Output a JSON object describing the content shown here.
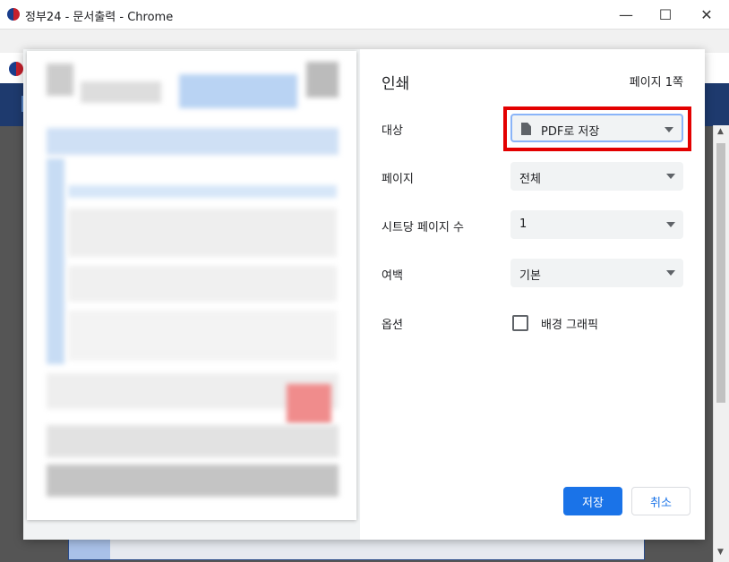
{
  "window": {
    "title": "정부24 - 문서출력 - Chrome"
  },
  "window_controls": {
    "minimize": "—",
    "maximize": "☐",
    "close": "✕"
  },
  "print": {
    "heading": "인쇄",
    "page_count": "페이지 1쪽",
    "destination": {
      "label": "대상",
      "value": "PDF로 저장"
    },
    "pages": {
      "label": "페이지",
      "value": "전체"
    },
    "pages_per_sheet": {
      "label": "시트당 페이지 수",
      "value": "1"
    },
    "margins": {
      "label": "여백",
      "value": "기본"
    },
    "options": {
      "label": "옵션",
      "background_graphics": "배경 그래픽"
    },
    "save_button": "저장",
    "cancel_button": "취소"
  },
  "colors": {
    "accent": "#1a73e8",
    "highlight": "#e30000"
  }
}
